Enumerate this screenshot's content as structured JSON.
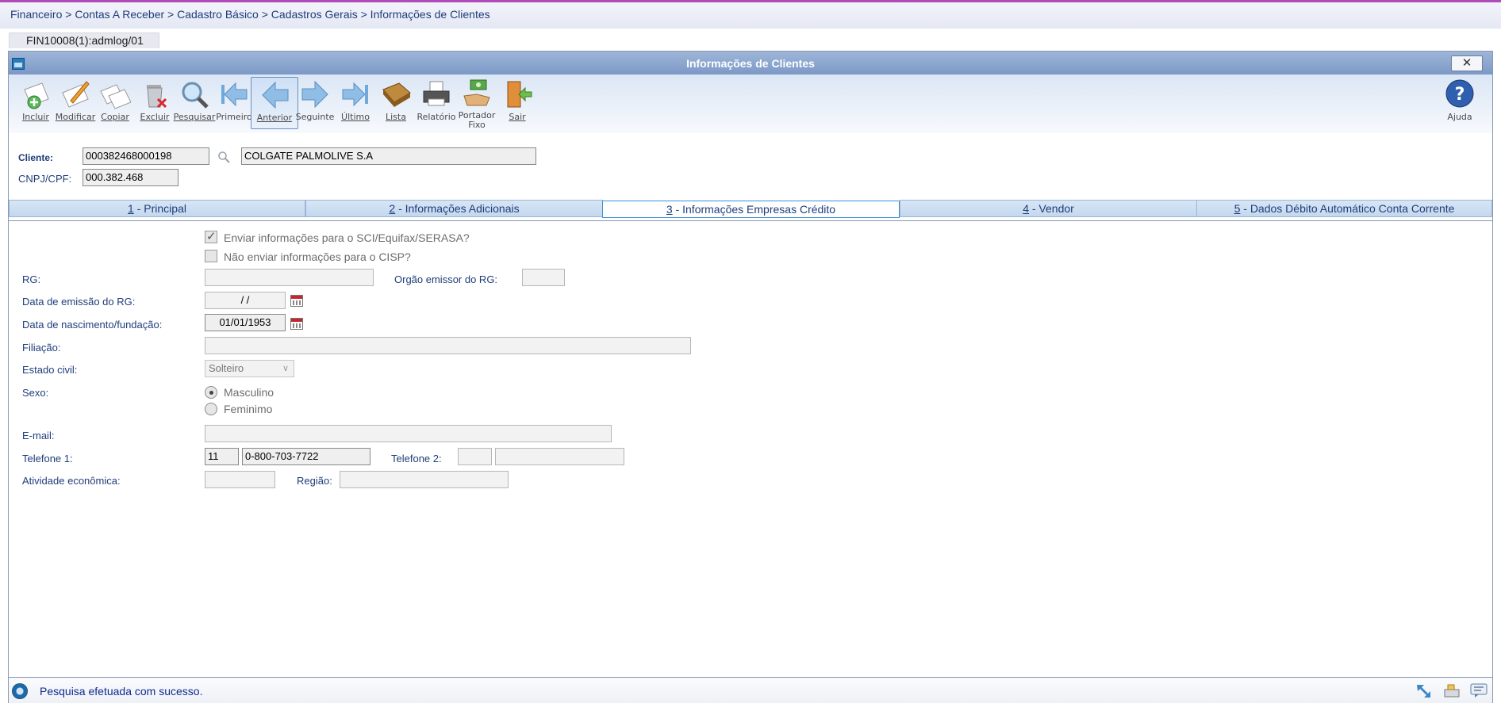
{
  "breadcrumb": "Financeiro > Contas A Receber > Cadastro Básico > Cadastros Gerais > Informações de Clientes",
  "session_tab": "FIN10008(1):admlog/01",
  "window": {
    "title": "Informações de Clientes",
    "close_label": "✕"
  },
  "toolbar": {
    "incluir": "Incluir",
    "modificar": "Modificar",
    "copiar": "Copiar",
    "excluir": "Excluir",
    "pesquisar": "Pesquisar",
    "primeiro": "Primeiro",
    "anterior": "Anterior",
    "seguinte": "Seguinte",
    "ultimo": "Último",
    "lista": "Lista",
    "relatorio": "Relatório",
    "portador_1": "Portador",
    "portador_2": "Fixo",
    "sair": "Sair",
    "ajuda": "Ajuda"
  },
  "header": {
    "cliente_label": "Cliente:",
    "cliente_code": "000382468000198",
    "cliente_name": "COLGATE PALMOLIVE S.A",
    "cnpj_label": "CNPJ/CPF:",
    "cnpj_value": "000.382.468"
  },
  "tabs": [
    {
      "key": "1",
      "label": " - Principal"
    },
    {
      "key": "2",
      "label": " - Informações Adicionais"
    },
    {
      "key": "3",
      "label": " - Informações Empresas Crédito"
    },
    {
      "key": "4",
      "label": " - Vendor"
    },
    {
      "key": "5",
      "label": " - Dados Débito Automático Conta Corrente"
    }
  ],
  "form": {
    "chk_serasa": "Enviar informações para o SCI/Equifax/SERASA?",
    "chk_cisp": "Não enviar informações para o CISP?",
    "rg_label": "RG:",
    "rg_value": "",
    "orgao_label": "Orgão emissor do RG:",
    "orgao_value": "",
    "emissao_label": "Data de emissão do RG:",
    "emissao_value": "/  /",
    "nascimento_label": "Data de nascimento/fundação:",
    "nascimento_value": "01/01/1953",
    "filiacao_label": "Filiação:",
    "filiacao_value": "",
    "estado_label": "Estado civil:",
    "estado_value": "Solteiro",
    "sexo_label": "Sexo:",
    "sexo_m": "Masculino",
    "sexo_f": "Feminimo",
    "email_label": "E-mail:",
    "email_value": "",
    "tel1_label": "Telefone 1:",
    "tel1_ddd": "11",
    "tel1_num": "0-800-703-7722",
    "tel2_label": "Telefone 2:",
    "tel2_ddd": "",
    "tel2_num": "",
    "atividade_label": "Atividade econômica:",
    "atividade_value": "",
    "regiao_label": "Região:",
    "regiao_value": ""
  },
  "status": {
    "message": "Pesquisa efetuada com sucesso."
  },
  "colors": {
    "accent": "#1f3d7a",
    "titlebar": "#8aa5cf",
    "top_border": "#b04cb7"
  }
}
